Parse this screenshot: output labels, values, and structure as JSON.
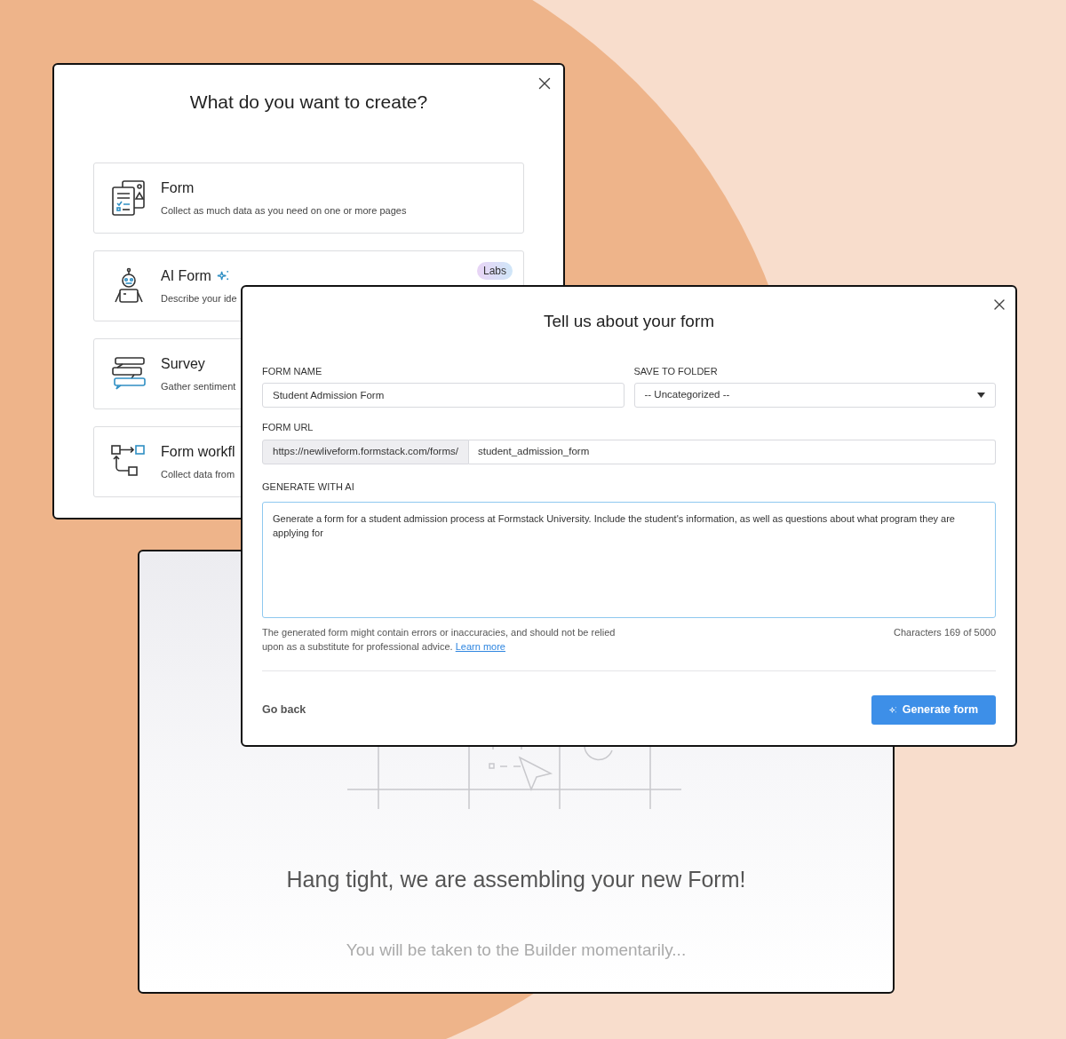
{
  "create_dialog": {
    "title": "What do you want to create?",
    "options": [
      {
        "kind": "form",
        "title": "Form",
        "description": "Collect as much data as you need on one or more pages"
      },
      {
        "kind": "ai",
        "title": "AI Form",
        "description": "Describe your ide",
        "badge": "Labs"
      },
      {
        "kind": "survey",
        "title": "Survey",
        "description": "Gather sentiment"
      },
      {
        "kind": "workflow",
        "title": "Form workfl",
        "description": "Collect data from"
      }
    ]
  },
  "loading_screen": {
    "title": "Hang tight, we are assembling your new Form!",
    "subtitle": "You will be taken to the Builder momentarily..."
  },
  "form_dialog": {
    "title": "Tell us about your form",
    "fields": [
      {
        "kind": "text",
        "label": "FORM NAME",
        "value": "Student Admission Form"
      },
      {
        "kind": "select",
        "label": "SAVE TO FOLDER",
        "value": "-- Uncategorized --"
      }
    ],
    "url": {
      "label": "FORM URL",
      "prefix": "https://newliveform.formstack.com/forms/",
      "value": "student_admission_form"
    },
    "ai": {
      "label": "GENERATE WITH AI",
      "value": "Generate a form for a student admission process at Formstack University. Include the student's information, as well as questions about what program they are applying for",
      "disclaimer": "The generated form might contain errors or inaccuracies, and should not be relied upon as a substitute for professional advice.",
      "link": "Learn more",
      "counter": "Characters 169 of 5000"
    },
    "back_button": "Go back",
    "primary_button": "Generate form"
  }
}
